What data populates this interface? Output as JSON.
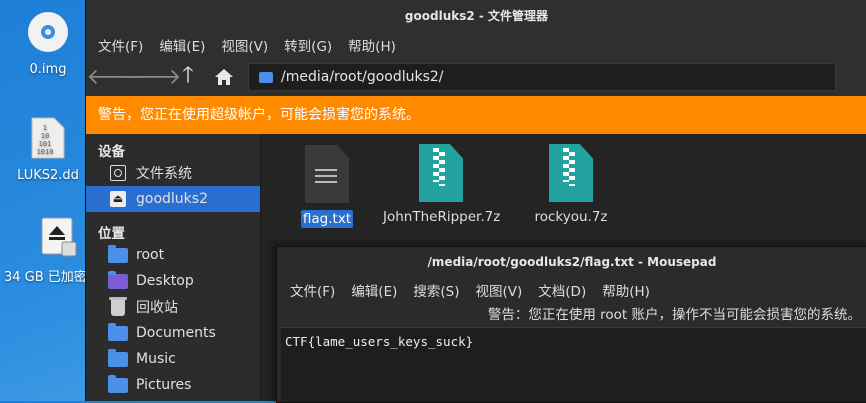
{
  "desktop": {
    "icons": [
      {
        "label": "0.img"
      },
      {
        "label": "LUKS2.dd"
      },
      {
        "label": "34 GB 已加密"
      }
    ],
    "luks_bits": "1\n10\n101\n1010"
  },
  "file_manager": {
    "title": "goodluks2 - 文件管理器",
    "menu": [
      "文件(F)",
      "编辑(E)",
      "视图(V)",
      "转到(G)",
      "帮助(H)"
    ],
    "path": "/media/root/goodluks2/",
    "warning": "警告，您正在使用超级帐户，可能会损害您的系统。",
    "sidebar": {
      "devices_header": "设备",
      "devices": [
        {
          "label": "文件系统",
          "icon": "harddisk-icon"
        },
        {
          "label": "goodluks2",
          "icon": "eject-icon",
          "selected": true
        }
      ],
      "places_header": "位置",
      "places": [
        {
          "label": "root",
          "icon": "home-folder-icon"
        },
        {
          "label": "Desktop",
          "icon": "desktop-folder-icon"
        },
        {
          "label": "回收站",
          "icon": "trash-icon"
        },
        {
          "label": "Documents",
          "icon": "documents-folder-icon"
        },
        {
          "label": "Music",
          "icon": "music-folder-icon"
        },
        {
          "label": "Pictures",
          "icon": "pictures-folder-icon"
        }
      ]
    },
    "files": [
      {
        "name": "flag.txt",
        "type": "text",
        "selected": true
      },
      {
        "name": "JohnTheRipper.7z",
        "type": "archive"
      },
      {
        "name": "rockyou.7z",
        "type": "archive"
      }
    ]
  },
  "mousepad": {
    "title": "/media/root/goodluks2/flag.txt - Mousepad",
    "menu": [
      "文件(F)",
      "编辑(E)",
      "搜索(S)",
      "视图(V)",
      "文档(D)",
      "帮助(H)"
    ],
    "warning": "警告：您正在使用 root 账户，操作不当可能会损害您的系统。",
    "content": "CTF{lame_users_keys_suck}"
  }
}
